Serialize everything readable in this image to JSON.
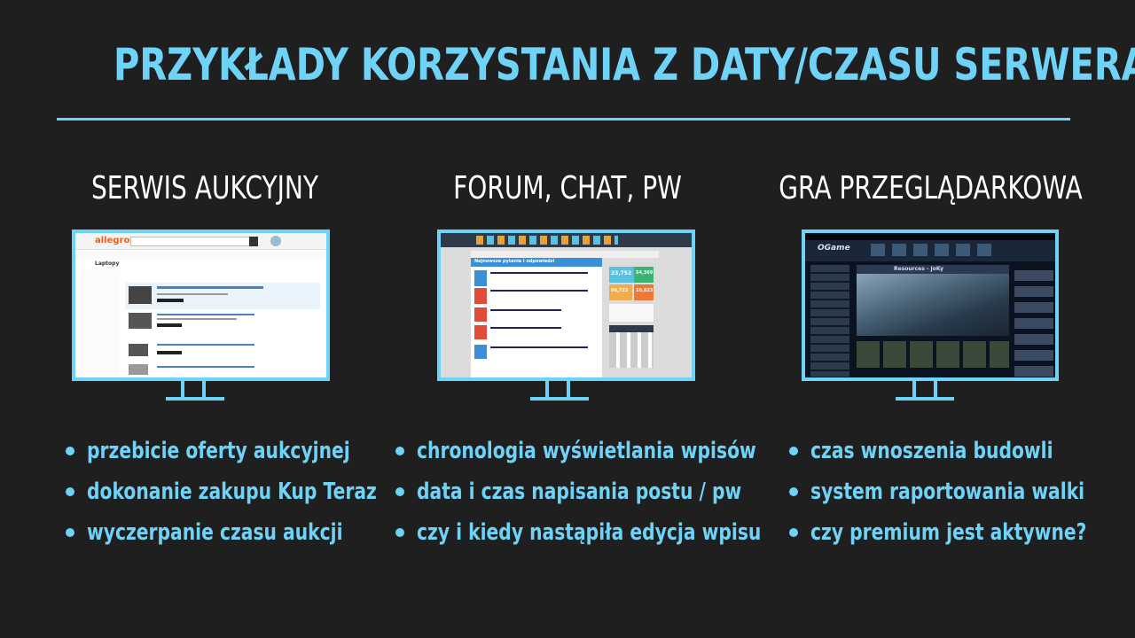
{
  "title": "PRZYKŁADY KORZYSTANIA Z DATY/CZASU SERWERA",
  "accent_color": "#6fd3f7",
  "columns": [
    {
      "heading": "SERWIS AUKCYJNY",
      "screenshot_logo": "allegro",
      "screenshot_heading": "Laptopy",
      "bullets": [
        "przebicie oferty aukcyjnej",
        "dokonanie zakupu Kup Teraz",
        "wyczerpanie czasu aukcji"
      ]
    },
    {
      "heading": "FORUM, CHAT, PW",
      "screenshot_heading": "Najnowsze pytania i odpowiedzi",
      "screenshot_stats": [
        "23,752",
        "54,369",
        "96,723",
        "10,823"
      ],
      "bullets": [
        "chronologia wyświetlania wpisów",
        "data i czas napisania postu / pw",
        "czy i kiedy nastąpiła edycja wpisu"
      ]
    },
    {
      "heading": "GRA PRZEGLĄDARKOWA",
      "screenshot_logo": "OGame",
      "screenshot_heading": "Resources - JoKy",
      "bullets": [
        "czas wnoszenia budowli",
        "system raportowania walki",
        "czy premium jest aktywne?"
      ]
    }
  ]
}
